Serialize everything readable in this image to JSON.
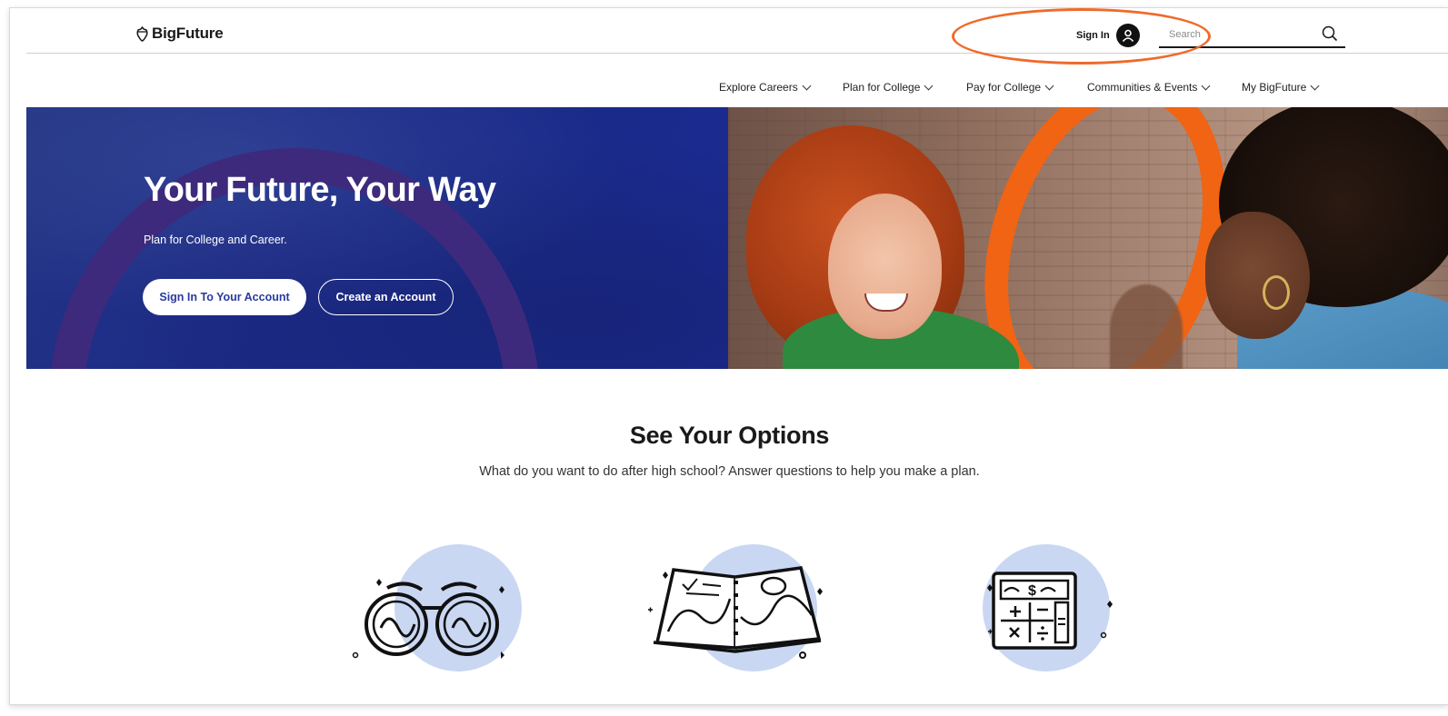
{
  "header": {
    "logo_text": "BigFuture",
    "sign_in_label": "Sign In",
    "search_placeholder": "Search"
  },
  "nav": {
    "items": [
      {
        "label": "Explore Careers"
      },
      {
        "label": "Plan for College"
      },
      {
        "label": "Pay for College"
      },
      {
        "label": "Communities & Events"
      },
      {
        "label": "My BigFuture"
      }
    ]
  },
  "hero": {
    "title": "Your Future, Your Way",
    "subtitle": "Plan for College and Career.",
    "primary_button": "Sign In To Your Account",
    "secondary_button": "Create an Account"
  },
  "options": {
    "title": "See Your Options",
    "subtitle": "What do you want to do after high school? Answer questions to help you make a plan.",
    "icons": [
      "binoculars-icon",
      "map-book-icon",
      "calculator-icon"
    ]
  },
  "colors": {
    "hero_blue": "#1c2a87",
    "accent_orange": "#ef6a2a",
    "icon_circle": "#c9d7f3",
    "primary_button_text": "#2a3b9c"
  }
}
